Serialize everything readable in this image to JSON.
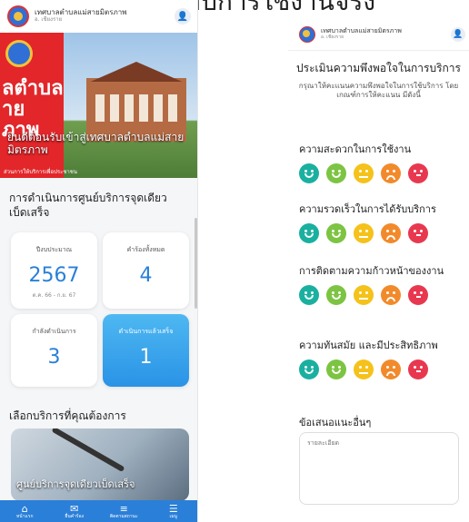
{
  "doc_title": "การทดสอบการใช้งานจริง",
  "org": {
    "name": "เทศบาลตำบลแม่สายมิตรภาพ",
    "district": "อ. เชียงราย"
  },
  "colors": {
    "brand_blue": "#2a7fd8",
    "hero_red": "#e2262a",
    "faces": [
      "#1ab0a0",
      "#7cc442",
      "#f5c21b",
      "#f28a2b",
      "#e8384f"
    ]
  },
  "hero": {
    "big_text": "ลตำบล\nาย\nภาพ",
    "caption": "ยินดีต้อนรับเข้าสู่เทศบาลตำบลแม่สายมิตรภาพ",
    "small": "ส่วนการให้บริการเพื่อประชาชน"
  },
  "left": {
    "section_title": "การดำเนินการศูนย์บริการจุดเดียวเบ็ดเสร็จ",
    "cards": [
      {
        "label": "ปีงบประมาณ",
        "value": "2567",
        "note": "ต.ค. 66 - ก.ย. 67"
      },
      {
        "label": "คำร้องทั้งหมด",
        "value": "4",
        "note": ""
      },
      {
        "label": "กำลังดำเนินการ",
        "value": "3",
        "note": ""
      },
      {
        "label": "ดำเนินการแล้วเสร็จ",
        "value": "1",
        "note": ""
      }
    ],
    "section2_title": "เลือกบริการที่คุณต้องการ",
    "service_label": "ศูนย์บริการจุดเดียวเบ็ดเสร็จ",
    "nav": [
      {
        "icon": "home-icon",
        "glyph": "⌂",
        "label": "หน้าแรก"
      },
      {
        "icon": "chat-icon",
        "glyph": "✉",
        "label": "ยื่นคำร้อง"
      },
      {
        "icon": "stack-icon",
        "glyph": "≡",
        "label": "ติดตามสถานะ"
      },
      {
        "icon": "menu-icon",
        "glyph": "☰",
        "label": "เมนู"
      }
    ]
  },
  "right": {
    "title": "ประเมินความพึงพอใจในการบริการ",
    "subtitle": "กรุณาให้คะแนนความพึงพอใจในการใช้บริการ โดยเกณฑ์การให้คะแนน มีดังนี้",
    "questions": [
      "ความสะดวกในการใช้งาน",
      "ความรวดเร็วในการได้รับบริการ",
      "การติดตามความก้าวหน้าของงาน",
      "ความทันสมัย และมีประสิทธิภาพ"
    ],
    "suggest_label": "ข้อเสนอแนะอื่นๆ",
    "suggest_placeholder": "รายละเอียด"
  }
}
